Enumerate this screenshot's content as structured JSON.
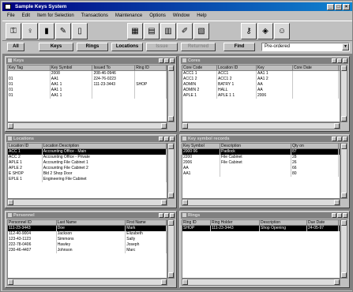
{
  "app": {
    "title": "Sample Keys System"
  },
  "menu": [
    "File",
    "Edit",
    "Item for Selection",
    "Transactions",
    "Maintenance",
    "Options",
    "Window",
    "Help"
  ],
  "toolbar_icons": [
    "keys-icon",
    "key-tag-icon",
    "locks-icon",
    "signature-icon",
    "door-icon",
    "keyring-icon",
    "floorplan-icon",
    "cabinet-icon",
    "report-icon",
    "sheet-icon",
    "key-icon",
    "person-icon"
  ],
  "buttons": {
    "all": "All",
    "keys": "Keys",
    "rings": "Rings",
    "locations": "Locations",
    "issue": "Issue",
    "returned": "Returned",
    "find": "Find"
  },
  "combo": {
    "value": "Pre-ordered"
  },
  "windows": {
    "keys": {
      "title": "Keys",
      "columns": [
        "Key Tag",
        "Key Symbol",
        "Issued To",
        "Ring ID"
      ],
      "rows": [
        [
          "",
          "2008",
          "208-46-0946",
          ""
        ],
        [
          "01",
          "AA1",
          "224-76-0223",
          ""
        ],
        [
          "01",
          "AA1 1",
          "111-23-3443",
          "SHOP"
        ],
        [
          "01",
          "AA1 1",
          "",
          ""
        ],
        [
          "01",
          "AA1 1",
          "",
          ""
        ]
      ]
    },
    "cores": {
      "title": "Cores",
      "columns": [
        "Core Code",
        "Location ID",
        "Key",
        "Core Date"
      ],
      "rows": [
        [
          "ACC1 1",
          "ACC1",
          "AA1 1",
          ""
        ],
        [
          "ACC1 2",
          "ACC1 2",
          "AA1 2",
          ""
        ],
        [
          "ADMIN",
          "BATRY 1",
          "AA",
          ""
        ],
        [
          "ADMIN 2",
          "HALL",
          "AA",
          ""
        ],
        [
          "APLE 1",
          "APLE 1 1",
          "2006",
          ""
        ]
      ]
    },
    "locations": {
      "title": "Locations",
      "columns": [
        "Location ID",
        "Location Description"
      ],
      "rows": [
        [
          "ACC 1",
          "Accounting Office - Main"
        ],
        [
          "ACC 2",
          "Accounting Office - Private"
        ],
        [
          "APLE 1",
          "Accounting File Cabinet 1"
        ],
        [
          "APLE 2",
          "Accounting File Cabinet 2"
        ],
        [
          "E SHOP",
          "Bld 2 Shop Door"
        ],
        [
          "EPLE 1",
          "Engineering File Cabinet"
        ]
      ]
    },
    "symbols": {
      "title": "Key symbol records",
      "columns": [
        "Key Symbol",
        "Description",
        "Qty on"
      ],
      "rows": [
        [
          "2000 06",
          "Padlock",
          "87"
        ],
        [
          "2200",
          "File Cabinet",
          "28"
        ],
        [
          "2006",
          "File Cabinet",
          "26"
        ],
        [
          "AA",
          "",
          "66"
        ],
        [
          "AA1",
          "",
          "80"
        ],
        [
          "",
          "",
          ""
        ]
      ]
    },
    "personnel": {
      "title": "Personnel",
      "columns": [
        "Personnel ID",
        "Last Name",
        "First Name"
      ],
      "rows": [
        [
          "111-23-3443",
          "Doe",
          "Mark"
        ],
        [
          "112-40-9004",
          "Jackson",
          "Elizabeth"
        ],
        [
          "123-43-1123",
          "Simmons",
          "Sally"
        ],
        [
          "222-78-0406",
          "Hawley",
          "Joseph"
        ],
        [
          "230-46-4407",
          "Johnson",
          "Marc"
        ]
      ]
    },
    "rings": {
      "title": "Rings",
      "columns": [
        "Ring ID",
        "Ring Holder",
        "Description",
        "Due Date"
      ],
      "rows": [
        [
          "SHOP",
          "111-23-3443",
          "Shop Opening",
          "24-05-97"
        ]
      ]
    }
  }
}
